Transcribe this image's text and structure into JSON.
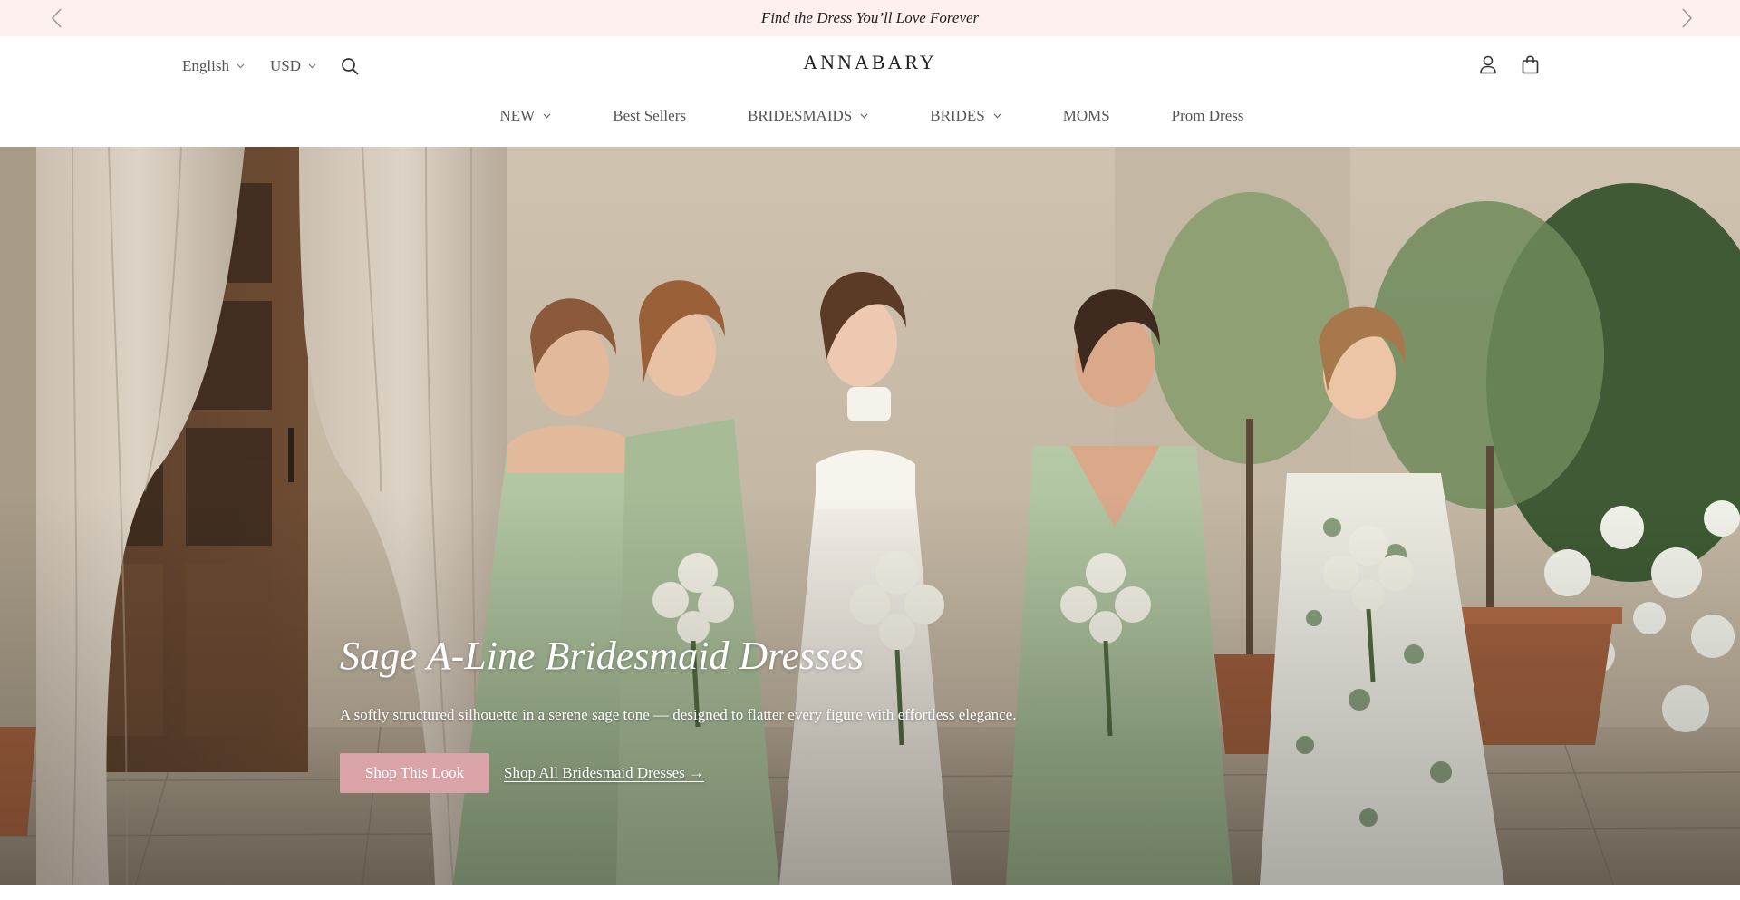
{
  "announcement": {
    "text": "Find the Dress You’ll Love Forever",
    "prev_icon": "chevron-left-icon",
    "next_icon": "chevron-right-icon"
  },
  "header": {
    "language": "English",
    "currency": "USD",
    "logo": "ANNABARY",
    "icons": {
      "search": "search-icon",
      "account": "user-icon",
      "cart": "bag-icon"
    }
  },
  "nav": {
    "items": [
      {
        "label": "NEW",
        "dropdown": true
      },
      {
        "label": "Best Sellers",
        "dropdown": false
      },
      {
        "label": "BRIDESMAIDS",
        "dropdown": true
      },
      {
        "label": "BRIDES",
        "dropdown": true
      },
      {
        "label": "MOMS",
        "dropdown": false
      },
      {
        "label": "Prom Dress",
        "dropdown": false
      }
    ]
  },
  "hero": {
    "title": "Sage A-Line Bridesmaid Dresses",
    "subtitle": "A softly structured silhouette in a serene sage tone — designed to flatter every figure with effortless elegance.",
    "primary_cta": "Shop This Look",
    "secondary_cta": "Shop All Bridesmaid Dresses →"
  },
  "colors": {
    "announcement_bg": "#fdf0ef",
    "cta_pink": "#d9a3a8",
    "sage": "#a9bf9b"
  }
}
